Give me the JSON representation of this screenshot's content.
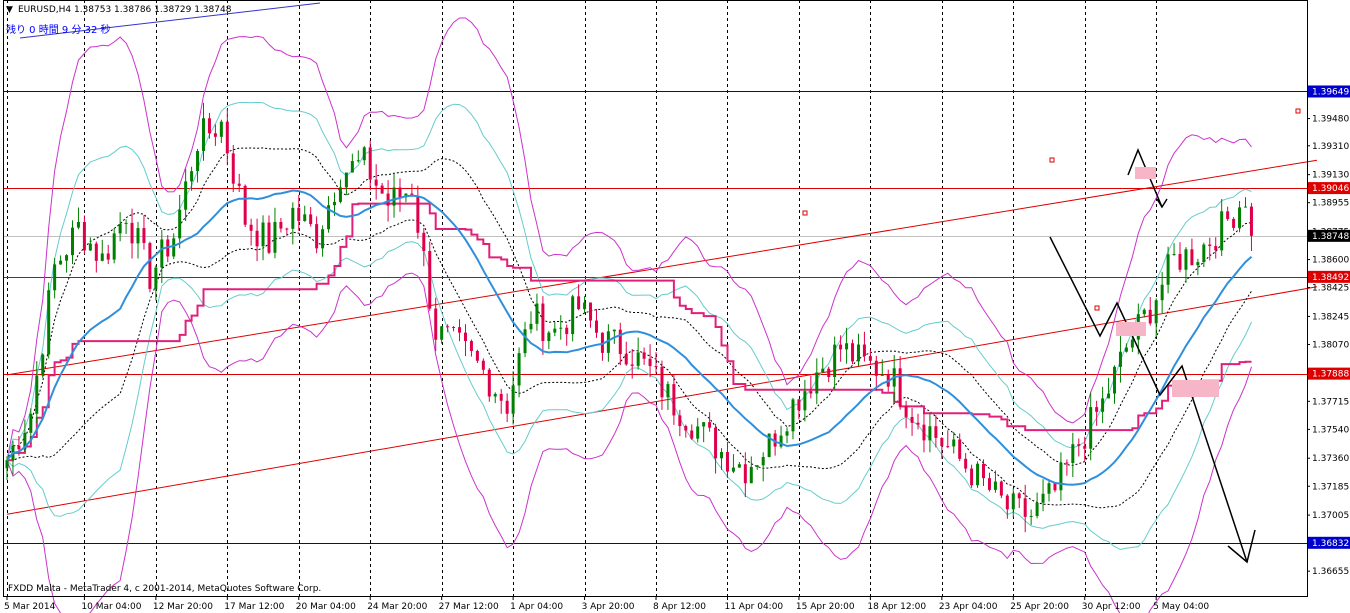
{
  "header": {
    "arrow": "▼",
    "title": "EURUSD,H4  1.38753 1.38786 1.38729 1.38748",
    "timer": "残り 0 時間 9 分 32 秒"
  },
  "footer": {
    "text": "FXDD Malta - MetaTrader 4, c 2001-2014, MetaQuotes Software Corp."
  },
  "colors": {
    "background": "#ffffff",
    "bull_candle": "#008000",
    "bear_candle": "#e0004a",
    "ma_blue": "#2f8fdc",
    "envelope_magenta": "#cc33cc",
    "envelope_cyan": "#66cccc",
    "ichimoku_pink": "#e0207a",
    "trend_red": "#dd0000",
    "level_blue": "#0000cc",
    "forecast_black": "#000000",
    "zone_pink": "#f6b6c8"
  },
  "chart_data": {
    "type": "candlestick",
    "symbol": "EURUSD",
    "timeframe": "H4",
    "ohlc_header": {
      "open": 1.38753,
      "high": 1.38786,
      "low": 1.38729,
      "close": 1.38748
    },
    "ylim": [
      1.365,
      1.4022
    ],
    "y_ticks": [
      "1.39649",
      "1.39480",
      "1.39310",
      "1.39130",
      "1.38955",
      "1.38775",
      "1.38600",
      "1.38425",
      "1.38245",
      "1.38070",
      "1.37888",
      "1.37715",
      "1.37540",
      "1.37360",
      "1.37185",
      "1.37005",
      "1.36832",
      "1.36655"
    ],
    "x_ticks": [
      "5 Mar 2014",
      "10 Mar 04:00",
      "12 Mar 20:00",
      "17 Mar 12:00",
      "20 Mar 04:00",
      "24 Mar 20:00",
      "27 Mar 12:00",
      "1 Apr 04:00",
      "3 Apr 20:00",
      "8 Apr 12:00",
      "11 Apr 04:00",
      "15 Apr 20:00",
      "18 Apr 12:00",
      "23 Apr 04:00",
      "25 Apr 20:00",
      "30 Apr 12:00",
      "5 May 04:00"
    ],
    "bar_count": 210,
    "x_tick_bar_index": [
      0,
      13,
      25,
      37,
      49,
      61,
      73,
      85,
      97,
      109,
      121,
      133,
      145,
      157,
      169,
      181,
      193
    ],
    "closes_sampled_every_4_bars": [
      1.3735,
      1.3765,
      1.3855,
      1.388,
      1.386,
      1.389,
      1.385,
      1.3875,
      1.3935,
      1.3945,
      1.3885,
      1.387,
      1.389,
      1.3875,
      1.3915,
      1.392,
      1.3895,
      1.3905,
      1.3815,
      1.3805,
      1.379,
      1.377,
      1.3825,
      1.3815,
      1.383,
      1.381,
      1.3805,
      1.379,
      1.377,
      1.3755,
      1.374,
      1.373,
      1.3745,
      1.377,
      1.379,
      1.3805,
      1.3795,
      1.379,
      1.3765,
      1.375,
      1.3735,
      1.372,
      1.3705,
      1.37,
      1.3715,
      1.3745,
      1.377,
      1.3805,
      1.383,
      1.386,
      1.3865,
      1.388,
      1.39,
      1.388,
      1.385,
      1.384
    ],
    "level_lines": [
      {
        "label": "1.39649",
        "value": 1.39649,
        "color": "#0000cc"
      },
      {
        "label": "1.39046",
        "value": 1.39046,
        "color": "#dd0000"
      },
      {
        "label": "1.38748",
        "value": 1.38748,
        "color": "#000000",
        "current_price": true
      },
      {
        "label": "1.38492",
        "value": 1.38492,
        "color": "#dd0000"
      },
      {
        "label": "1.37888",
        "value": 1.37888,
        "color": "#dd0000"
      },
      {
        "label": "1.36832",
        "value": 1.36832,
        "color": "#0000cc"
      }
    ],
    "trend_channel": [
      {
        "from": [
          0,
          1.3788
        ],
        "to": [
          220,
          1.3922
        ]
      },
      {
        "from": [
          0,
          1.3701
        ],
        "to": [
          220,
          1.3843
        ]
      }
    ],
    "grid": "vertical dashed at x ticks"
  }
}
